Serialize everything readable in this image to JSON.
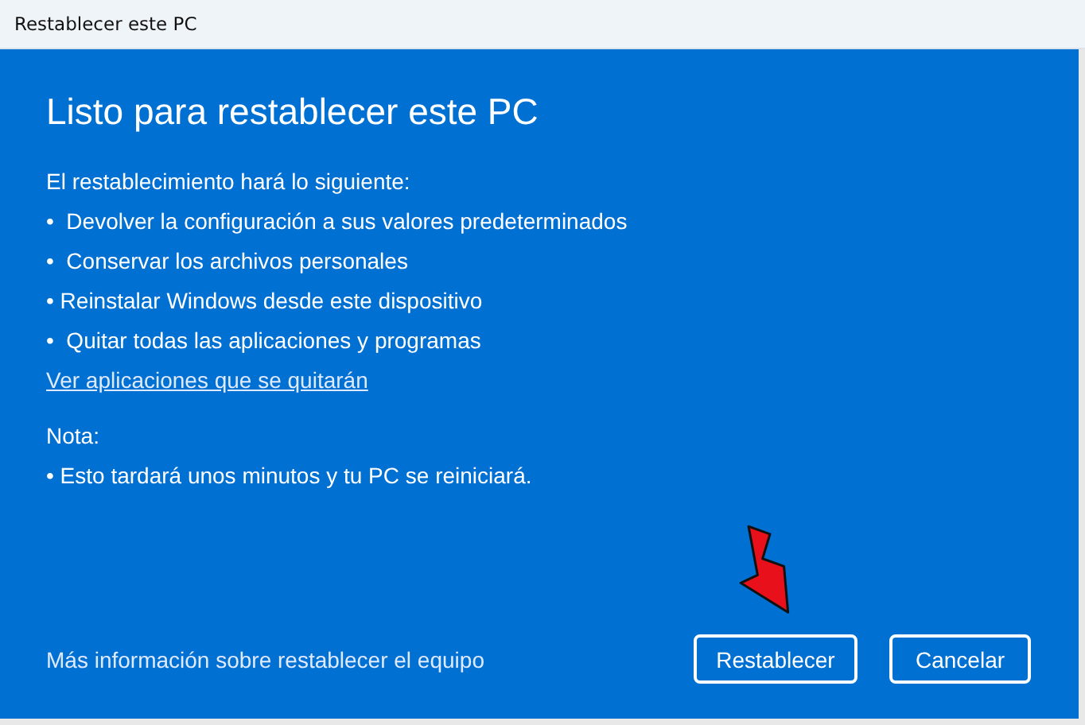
{
  "window": {
    "title": "Restablecer este PC"
  },
  "heading": "Listo para restablecer este PC",
  "intro": "El restablecimiento hará lo siguiente:",
  "items": [
    "•  Devolver la configuración a sus valores predeterminados",
    "•  Conservar los archivos personales",
    "• Reinstalar Windows desde este dispositivo",
    "•  Quitar todas las aplicaciones y programas"
  ],
  "link": "Ver aplicaciones que se quitarán",
  "note": {
    "label": "Nota:",
    "text": "• Esto tardará unos minutos y tu PC se reiniciará."
  },
  "footer": {
    "link": "Más información sobre restablecer el equipo",
    "buttons": [
      "Restablecer",
      "Cancelar"
    ]
  }
}
